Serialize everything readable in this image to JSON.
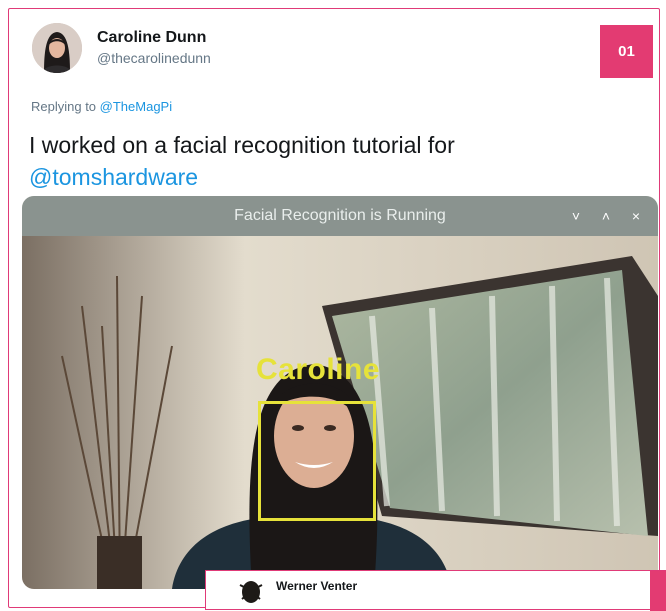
{
  "badge": "01",
  "tweet": {
    "author_name": "Caroline Dunn",
    "author_handle": "@thecarolinedunn",
    "reply_prefix": "Replying to ",
    "reply_to": "@TheMagPi",
    "text": "I worked on a facial recognition tutorial for",
    "mention": "@tomshardware"
  },
  "window": {
    "title": "Facial Recognition is Running",
    "controls": [
      "˅",
      "˄",
      "×"
    ]
  },
  "detection": {
    "label": "Caroline"
  },
  "next_reply": {
    "author_name": "Werner Venter"
  },
  "colors": {
    "accent": "#e33b72",
    "link": "#1b95e0",
    "detection": "#e6e23a"
  }
}
